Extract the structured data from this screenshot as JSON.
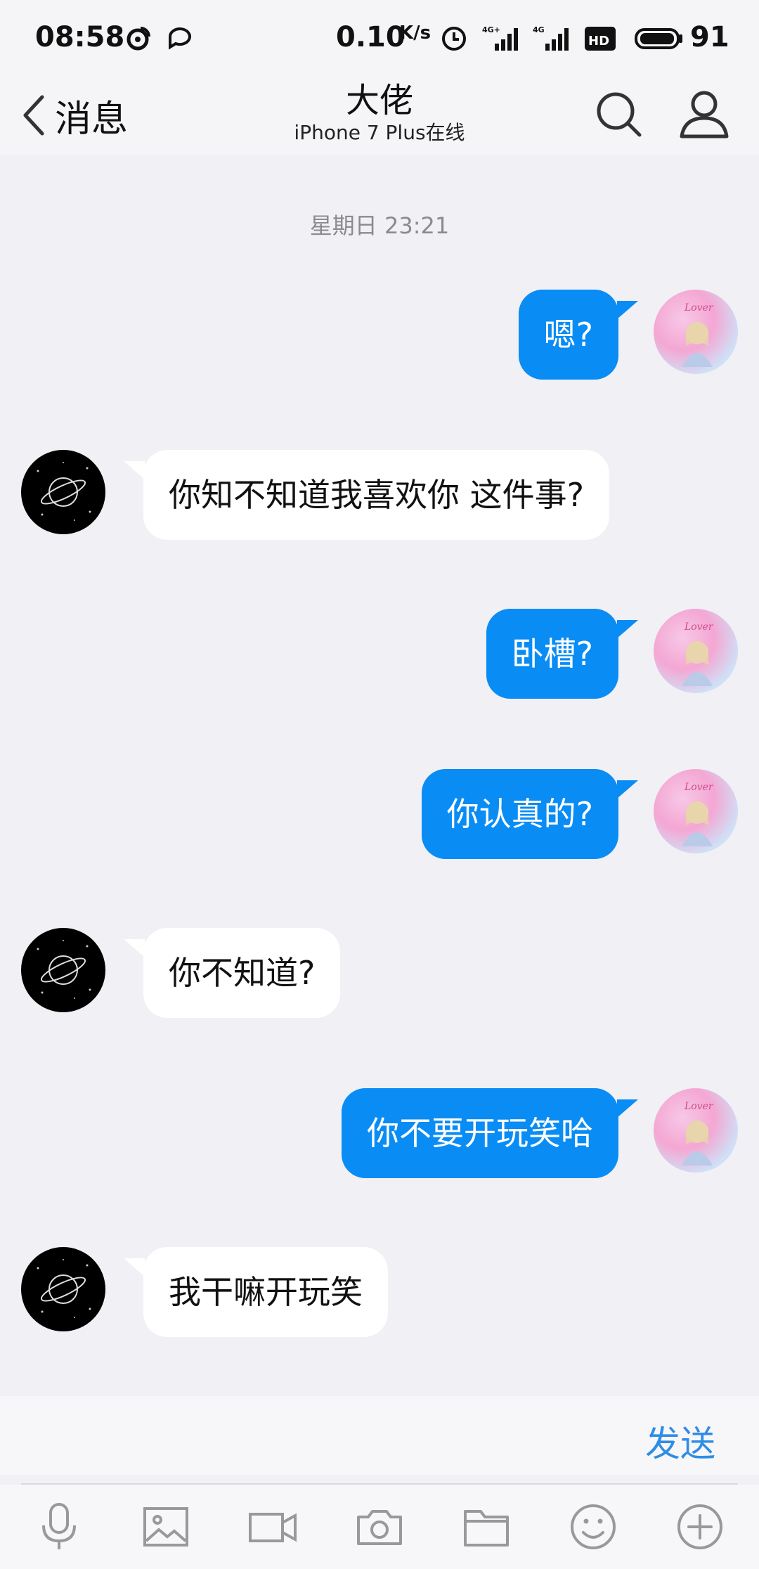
{
  "status_bar": {
    "time": "08:58",
    "network_speed": "0.10",
    "network_speed_unit": "K/s",
    "battery_level": "91",
    "icons": [
      "weibo-icon",
      "chat-bubble-icon",
      "alarm-icon",
      "signal-4g-plus-icon",
      "signal-4g-icon",
      "hd-volte-icon",
      "battery-icon"
    ]
  },
  "header": {
    "back_label": "消息",
    "title": "大佬",
    "subtitle": "iPhone 7 Plus在线"
  },
  "chat": {
    "timestamp": "星期日 23:21",
    "messages": [
      {
        "from": "me",
        "text": "嗯?"
      },
      {
        "from": "them",
        "text": "你知不知道我喜欢你 这件事?"
      },
      {
        "from": "me",
        "text": "卧槽?"
      },
      {
        "from": "me",
        "text": "你认真的?"
      },
      {
        "from": "them",
        "text": "你不知道?"
      },
      {
        "from": "me",
        "text": "你不要开玩笑哈"
      },
      {
        "from": "them",
        "text": "我干嘛开玩笑"
      }
    ]
  },
  "input": {
    "value": "",
    "send_label": "发送"
  },
  "toolbar": [
    "microphone-icon",
    "image-icon",
    "video-icon",
    "camera-icon",
    "folder-icon",
    "emoji-icon",
    "plus-icon"
  ],
  "colors": {
    "my_bubble": "#0a8cf5",
    "their_bubble": "#ffffff",
    "background": "#f0f0f5",
    "send": "#2f8de4"
  }
}
